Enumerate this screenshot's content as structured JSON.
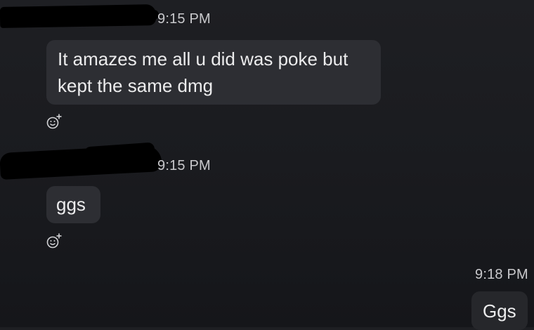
{
  "messages": [
    {
      "direction": "incoming",
      "sender": "",
      "time": "9:15 PM",
      "text_lines": [
        "It amazes me all u did was poke but",
        "kept the same dmg"
      ],
      "reaction_icon": "add-reaction-icon"
    },
    {
      "direction": "incoming",
      "sender": "",
      "time": "9:15 PM",
      "text_lines": [
        "ggs"
      ],
      "reaction_icon": "add-reaction-icon"
    },
    {
      "direction": "outgoing",
      "time": "9:18 PM",
      "text_lines": [
        "Ggs"
      ]
    }
  ],
  "colors": {
    "background": "#1b1c20",
    "bubble_incoming": "#2d2e33",
    "bubble_outgoing": "#26272b",
    "text": "#ececed",
    "timestamp": "#c9c9cc",
    "redaction": "#000000"
  }
}
